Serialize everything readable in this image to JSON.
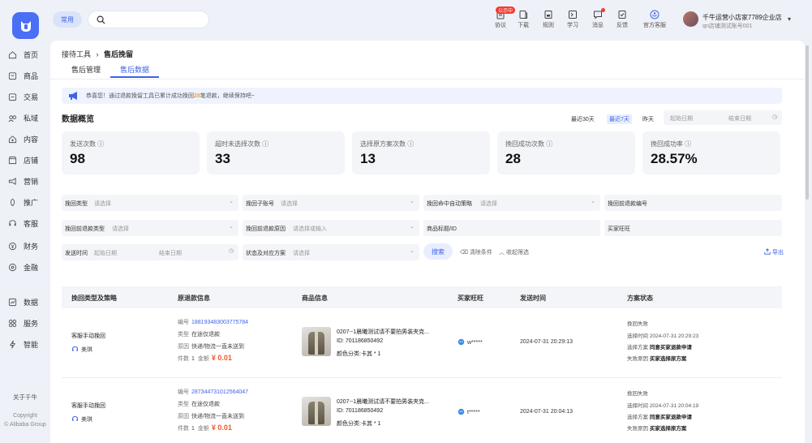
{
  "sidebar": {
    "items": [
      {
        "label": "首页",
        "icon": "home-icon"
      },
      {
        "label": "商品",
        "icon": "goods-icon"
      },
      {
        "label": "交易",
        "icon": "trade-icon"
      },
      {
        "label": "私域",
        "icon": "private-domain-icon"
      },
      {
        "label": "内容",
        "icon": "content-icon"
      },
      {
        "label": "店铺",
        "icon": "store-icon"
      },
      {
        "label": "营销",
        "icon": "marketing-icon"
      },
      {
        "label": "推广",
        "icon": "promotion-icon"
      },
      {
        "label": "客服",
        "icon": "customer-service-icon"
      },
      {
        "label": "财务",
        "icon": "finance-icon"
      },
      {
        "label": "金融",
        "icon": "money-icon"
      },
      {
        "label": "数据",
        "icon": "data-icon"
      },
      {
        "label": "服务",
        "icon": "service-icon"
      },
      {
        "label": "智能",
        "icon": "smart-icon"
      }
    ],
    "about": "关于千牛",
    "copyright": "Copyright",
    "company": "© Alibaba Group"
  },
  "topbar": {
    "chip": "常用",
    "search_placeholder": "",
    "tools": [
      {
        "label": "协议",
        "icon": "agreement-icon",
        "badge": "公示中"
      },
      {
        "label": "下载",
        "icon": "download-icon"
      },
      {
        "label": "规则",
        "icon": "rules-icon"
      },
      {
        "label": "学习",
        "icon": "learn-icon"
      },
      {
        "label": "消息",
        "icon": "message-icon"
      },
      {
        "label": "反馈",
        "icon": "feedback-icon"
      },
      {
        "label": "官方客服",
        "icon": "official-service-icon"
      }
    ],
    "user_name": "千牛运营小店家7789企业店",
    "user_sub": "qn店铺测试账号001"
  },
  "breadcrumb": {
    "parent": "接待工具",
    "sep": "›",
    "current": "售后挽留"
  },
  "tabs": [
    "售后管理",
    "售后数据"
  ],
  "notice": {
    "pre": "恭喜您！通过退款挽留工具已累计成功挽回",
    "count": "28",
    "post": "笔退款，继续保持吧~"
  },
  "overview": {
    "title": "数据概览",
    "ranges": [
      "最近30天",
      "最近7天",
      "昨天"
    ],
    "date_start": "起始日期",
    "date_end": "结束日期",
    "cards": [
      {
        "label": "发送次数",
        "value": "98"
      },
      {
        "label": "超时未选择次数",
        "value": "33"
      },
      {
        "label": "选择原方案次数",
        "value": "13"
      },
      {
        "label": "挽回成功次数",
        "value": "28"
      },
      {
        "label": "挽回成功率",
        "value": "28.57%"
      }
    ]
  },
  "filters": [
    {
      "label": "挽回类型",
      "placeholder": "请选择",
      "caret": "⌄"
    },
    {
      "label": "挽回子账号",
      "placeholder": "请选择",
      "caret": "⌄"
    },
    {
      "label": "挽回命中自动策略",
      "placeholder": "请选择",
      "caret": "⌄"
    },
    {
      "label": "挽回前退款编号",
      "placeholder": "",
      "caret": ""
    },
    {
      "label": "挽回前退款类型",
      "placeholder": "请选择",
      "caret": "⌄"
    },
    {
      "label": "挽回前退款原因",
      "placeholder": "请选择或输入",
      "caret": "⌄"
    },
    {
      "label": "商品标题/ID",
      "placeholder": "",
      "caret": ""
    },
    {
      "label": "买家旺旺",
      "placeholder": "",
      "caret": ""
    },
    {
      "label": "发送时间",
      "placeholder": "起始日期",
      "placeholder2": "结束日期",
      "caret": "◷"
    },
    {
      "label": "状态及对应方案",
      "placeholder": "请选择",
      "caret": "⌄"
    }
  ],
  "actions": {
    "search": "搜索",
    "clear": "清除条件",
    "collapse": "收起筛选",
    "export": "导出"
  },
  "table": {
    "headers": [
      "挽回类型及策略",
      "原退款信息",
      "商品信息",
      "买家旺旺",
      "发送时间",
      "方案状态"
    ],
    "rows": [
      {
        "type": "客服手动挽回",
        "agent": "美琪",
        "no_label": "编号",
        "no": "1881934830037757​84",
        "kind_label": "类型",
        "kind": "在途仅退款",
        "reason_label": "原因",
        "reason": "快递/物流一直未送到",
        "qty_label": "件数",
        "qty": "1",
        "amt_label": "金额",
        "amount": "¥ 0.01",
        "product_title": "0207--1晨曦测试请不要拍男装夹克...",
        "product_id": "ID: 701186850492",
        "product_sku": "颜色分类:卡其 * 1",
        "buyer": "w*****",
        "time": "2024-07-31 20:29:13",
        "status": "挽回失败",
        "s1_label": "选择时间",
        "s1": "2024-07-31 20:29:23",
        "s2_label": "选择方案",
        "s2": "同意买家退款申请",
        "s3_label": "失败原因",
        "s3": "买家选择原方案"
      },
      {
        "type": "客服手动挽回",
        "agent": "美琪",
        "no_label": "编号",
        "no": "2873447310125640​47",
        "kind_label": "类型",
        "kind": "在途仅退款",
        "reason_label": "原因",
        "reason": "快递/物流一直未送到",
        "qty_label": "件数",
        "qty": "1",
        "amt_label": "金额",
        "amount": "¥ 0.01",
        "product_title": "0207--1晨曦测试请不要拍男装夹克...",
        "product_id": "ID: 701186850492",
        "product_sku": "颜色分类:卡其 * 1",
        "buyer": "t*****",
        "time": "2024-07-31 20:04:13",
        "status": "挽回失败",
        "s1_label": "选择时间",
        "s1": "2024-07-31 20:04:19",
        "s2_label": "选择方案",
        "s2": "同意买家退款申请",
        "s3_label": "失败原因",
        "s3": "买家选择原方案"
      }
    ]
  }
}
